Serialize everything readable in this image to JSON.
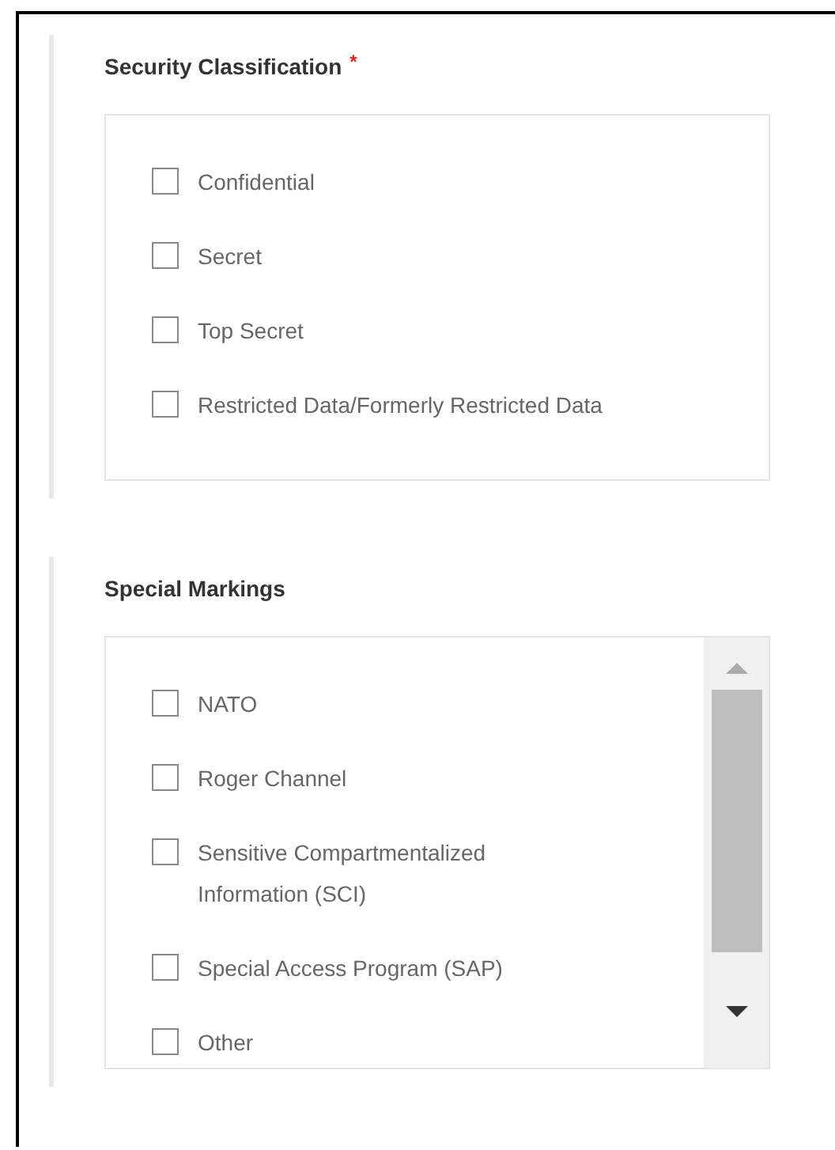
{
  "sections": [
    {
      "title": "Security Classification",
      "required_mark": "*",
      "scrollable": false,
      "options": [
        {
          "label": "Confidential",
          "checked": false
        },
        {
          "label": "Secret",
          "checked": false
        },
        {
          "label": "Top Secret",
          "checked": false
        },
        {
          "label": "Restricted Data/Formerly Restricted Data",
          "checked": false
        }
      ]
    },
    {
      "title": "Special Markings",
      "scrollable": true,
      "options": [
        {
          "label": "NATO",
          "checked": false
        },
        {
          "label": "Roger Channel",
          "checked": false
        },
        {
          "label": "Sensitive Compartmentalized Information (SCI)",
          "checked": false
        },
        {
          "label": "Special Access Program (SAP)",
          "checked": false
        },
        {
          "label": "Other",
          "checked": false
        }
      ]
    }
  ]
}
